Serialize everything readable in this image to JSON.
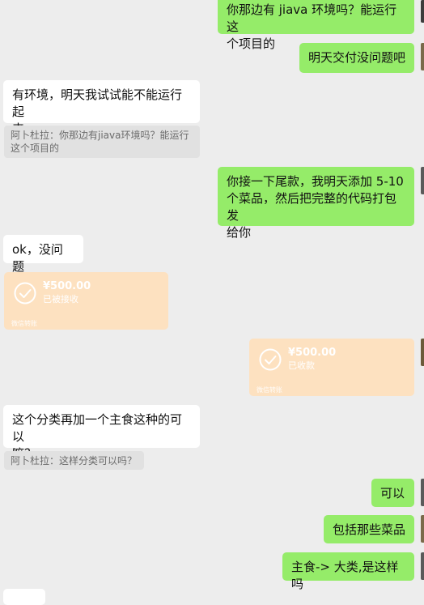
{
  "messages": {
    "m1": "你那边有 jiava 环境吗？能运行这\n个项目的",
    "m2": "明天交付没问题吧",
    "m3": "有环境，明天我试试能不能运行起\n来",
    "q1": "阿卜杜拉：你那边有jiava环境吗？能运行\n这个项目的",
    "m4": "你接一下尾款，我明天添加 5-10\n个菜品，然后把完整的代码打包发\n给你",
    "m5": "ok，没问题",
    "m6": "这个分类再加一个主食这种的可以\n嘛？",
    "q2": "阿卜杜拉：这样分类可以吗？",
    "m7": "可以",
    "m8": "包括那些菜品",
    "m9": "主食-> 大类,是这样吗"
  },
  "transfers": {
    "t1": {
      "amount": "¥500.00",
      "status": "已被接收",
      "foot": "微信转账"
    },
    "t2": {
      "amount": "¥500.00",
      "status": "已收款",
      "foot": "微信转账"
    }
  },
  "colors": {
    "background": "#ededed",
    "bubble_in": "#ffffff",
    "bubble_out": "#95ec69",
    "transfer": "#fde1c0"
  }
}
